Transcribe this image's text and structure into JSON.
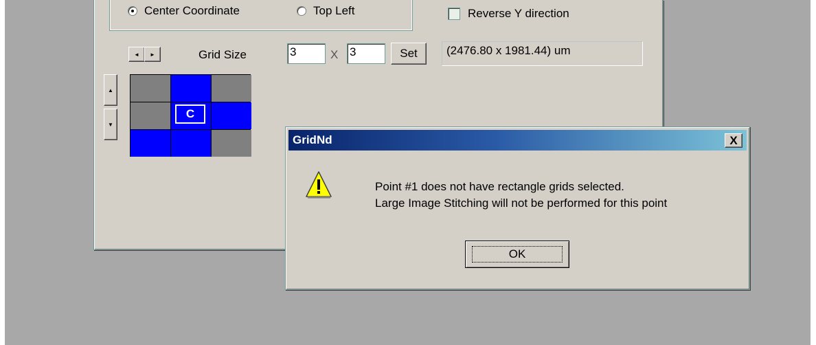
{
  "main_window": {
    "origin_options": [
      {
        "label": "Center Coordinate",
        "selected": true
      },
      {
        "label": "Top Left",
        "selected": false
      }
    ],
    "reverse_y": {
      "label": "Reverse Y direction",
      "checked": false
    },
    "left_arrow": "◄",
    "right_arrow": "►",
    "up_arrow": "▲",
    "down_arrow": "▼",
    "grid_size_label": "Grid Size",
    "grid_cols": "3",
    "times_sign": "X",
    "grid_rows": "3",
    "set_label": "Set",
    "dimensions": "(2476.80 x 1981.44) um",
    "grid_cells": [
      "gray",
      "blue",
      "gray",
      "gray",
      "blue",
      "blue",
      "blue",
      "blue",
      "gray"
    ],
    "center_cell_label": "C",
    "colors": {
      "blue": "#0000ff",
      "gray": "#808080"
    }
  },
  "dialog": {
    "title": "GridNd",
    "close_symbol": "X",
    "icon": "warning-icon",
    "message_line1": "Point #1 does not have rectangle grids selected.",
    "message_line2": "Large Image Stitching will not be performed for this point",
    "ok_label": "OK"
  }
}
